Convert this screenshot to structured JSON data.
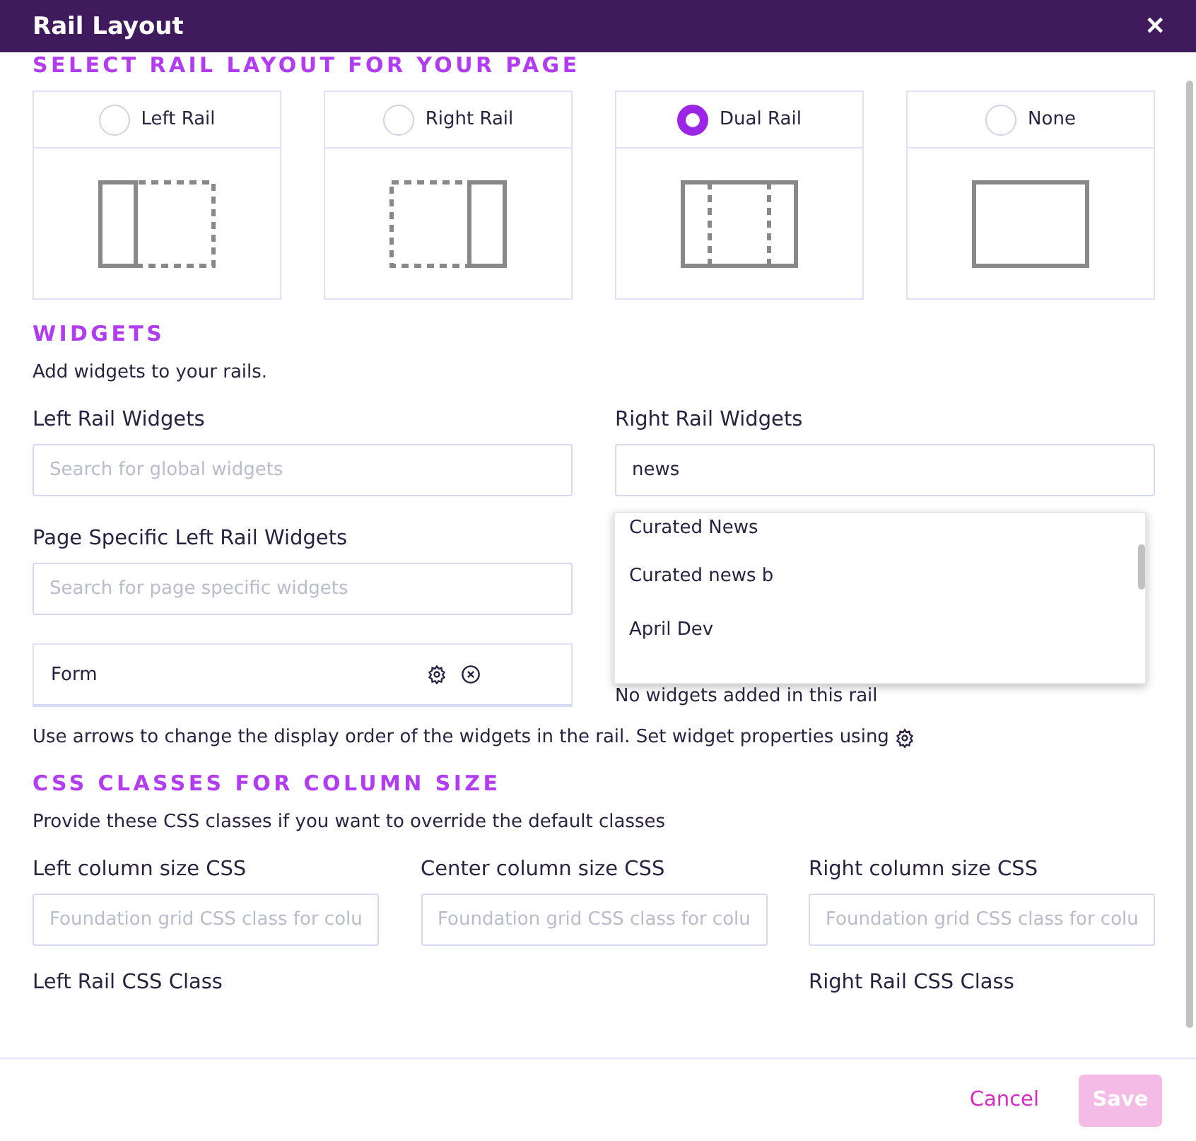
{
  "window": {
    "title": "Rail Layout",
    "close": "✕"
  },
  "layout_section": {
    "heading": "SELECT RAIL LAYOUT FOR YOUR PAGE",
    "options": [
      {
        "label": "Left Rail",
        "kind": "left",
        "selected": false
      },
      {
        "label": "Right Rail",
        "kind": "right",
        "selected": false
      },
      {
        "label": "Dual Rail",
        "kind": "dual",
        "selected": true
      },
      {
        "label": "None",
        "kind": "none",
        "selected": false
      }
    ]
  },
  "widgets_section": {
    "heading": "WIDGETS",
    "intro": "Add widgets to your rails.",
    "left": {
      "label": "Left Rail Widgets",
      "search": {
        "placeholder": "Search for global widgets"
      },
      "page_label": "Page Specific Left Rail Widgets",
      "page_search": {
        "placeholder": "Search for page specific widgets"
      },
      "items": [
        {
          "name": "Form"
        }
      ]
    },
    "right": {
      "label": "Right Rail Widgets",
      "search": {
        "value": "news"
      },
      "suggestions": [
        "Curated News",
        "Curated news b",
        "April Dev"
      ],
      "empty": "No widgets added in this rail"
    },
    "hint": "Use arrows to change the display order of the widgets in the rail. Set widget properties using"
  },
  "css_section": {
    "heading": "CSS CLASSES FOR COLUMN SIZE",
    "intro": "Provide these CSS classes if you want to override the default classes",
    "fields": [
      {
        "label": "Left column size CSS",
        "placeholder": "Foundation grid CSS class for colu"
      },
      {
        "label": "Center column size CSS",
        "placeholder": "Foundation grid CSS class for colu"
      },
      {
        "label": "Right column size CSS",
        "placeholder": "Foundation grid CSS class for colu"
      }
    ],
    "rail_labels": [
      "Left Rail CSS Class",
      "Right Rail CSS Class"
    ]
  },
  "footer": {
    "cancel": "Cancel",
    "save": "Save",
    "save_disabled": true
  }
}
